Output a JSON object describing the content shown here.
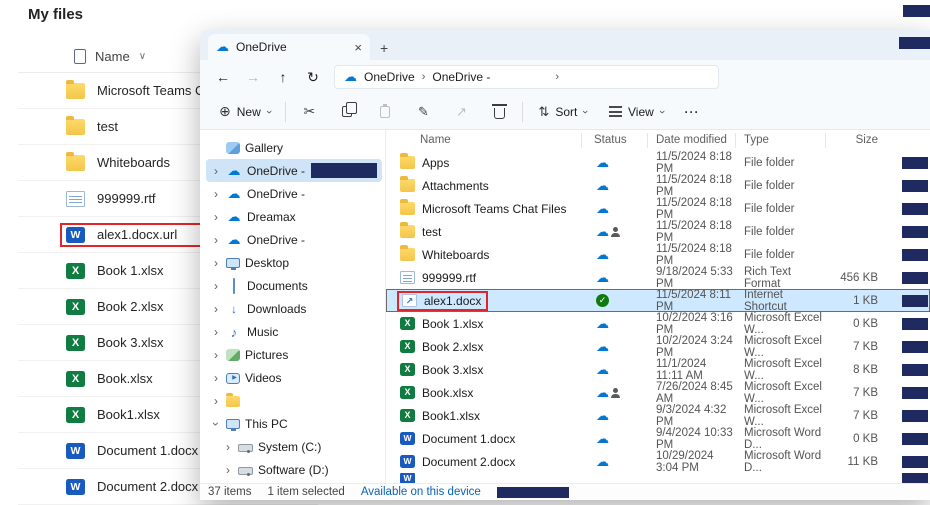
{
  "bg": {
    "title": "My files",
    "header": {
      "name": "Name"
    },
    "files": [
      {
        "name": "Microsoft Teams Chat",
        "icon": "folder"
      },
      {
        "name": "test",
        "icon": "folder"
      },
      {
        "name": "Whiteboards",
        "icon": "folder"
      },
      {
        "name": "999999.rtf",
        "icon": "rtf-file"
      },
      {
        "name": "alex1.docx.url",
        "icon": "word-file",
        "highlighted_red_box": true
      },
      {
        "name": "Book 1.xlsx",
        "icon": "excel-file"
      },
      {
        "name": "Book 2.xlsx",
        "icon": "excel-file"
      },
      {
        "name": "Book 3.xlsx",
        "icon": "excel-file"
      },
      {
        "name": "Book.xlsx",
        "icon": "excel-file"
      },
      {
        "name": "Book1.xlsx",
        "icon": "excel-file"
      },
      {
        "name": "Document 1.docx",
        "icon": "word-file"
      },
      {
        "name": "Document 2.docx",
        "icon": "word-file"
      }
    ]
  },
  "explorer": {
    "tab_title": "OneDrive",
    "breadcrumb": {
      "root": "OneDrive",
      "second": "OneDrive -"
    },
    "toolbar": {
      "new": "New",
      "sort": "Sort",
      "view": "View",
      "more": "···",
      "icons": [
        "new",
        "cut",
        "copy",
        "paste",
        "rename",
        "share",
        "delete",
        "sort",
        "view",
        "more"
      ]
    },
    "nav_icons": [
      "back",
      "forward",
      "up",
      "refresh"
    ],
    "sidebar": [
      {
        "label": "Gallery",
        "icon": "gallery"
      },
      {
        "label": "OneDrive -",
        "icon": "cloud",
        "selected": true,
        "redacted": true
      },
      {
        "label": "OneDrive -",
        "icon": "cloud"
      },
      {
        "label": "Dreamax",
        "icon": "cloud"
      },
      {
        "label": "OneDrive -",
        "icon": "cloud"
      },
      {
        "label": "Desktop",
        "icon": "desktop"
      },
      {
        "label": "Documents",
        "icon": "documents"
      },
      {
        "label": "Downloads",
        "icon": "downloads"
      },
      {
        "label": "Music",
        "icon": "music"
      },
      {
        "label": "Pictures",
        "icon": "pictures"
      },
      {
        "label": "Videos",
        "icon": "videos"
      },
      {
        "label": "",
        "icon": "folder"
      },
      {
        "label": "This PC",
        "icon": "this-pc",
        "expanded": true
      },
      {
        "label": "System (C:)",
        "icon": "drive"
      },
      {
        "label": "Software (D:)",
        "icon": "drive"
      }
    ],
    "columns": [
      "Name",
      "Status",
      "Date modified",
      "Type",
      "Size"
    ],
    "rows": [
      {
        "name": "Apps",
        "icon": "folder",
        "status": "cloud",
        "modified": "11/5/2024 8:18 PM",
        "type": "File folder",
        "size": ""
      },
      {
        "name": "Attachments",
        "icon": "folder",
        "status": "cloud",
        "modified": "11/5/2024 8:18 PM",
        "type": "File folder",
        "size": ""
      },
      {
        "name": "Microsoft Teams Chat Files",
        "icon": "folder",
        "status": "cloud",
        "modified": "11/5/2024 8:18 PM",
        "type": "File folder",
        "size": ""
      },
      {
        "name": "test",
        "icon": "folder",
        "status": "cloud-shared",
        "modified": "11/5/2024 8:18 PM",
        "type": "File folder",
        "size": ""
      },
      {
        "name": "Whiteboards",
        "icon": "folder",
        "status": "cloud",
        "modified": "11/5/2024 8:18 PM",
        "type": "File folder",
        "size": ""
      },
      {
        "name": "999999.rtf",
        "icon": "rtf-file",
        "status": "cloud",
        "modified": "9/18/2024 5:33 PM",
        "type": "Rich Text Format",
        "size": "456 KB"
      },
      {
        "name": "alex1.docx",
        "icon": "internet-shortcut",
        "status": "synced",
        "modified": "11/5/2024 8:11 PM",
        "type": "Internet Shortcut",
        "size": "1 KB",
        "selected": true,
        "highlighted_red_box": true
      },
      {
        "name": "Book 1.xlsx",
        "icon": "excel-file",
        "status": "cloud",
        "modified": "10/2/2024 3:16 PM",
        "type": "Microsoft Excel W...",
        "size": "0 KB"
      },
      {
        "name": "Book 2.xlsx",
        "icon": "excel-file",
        "status": "cloud",
        "modified": "10/2/2024 3:24 PM",
        "type": "Microsoft Excel W...",
        "size": "7 KB"
      },
      {
        "name": "Book 3.xlsx",
        "icon": "excel-file",
        "status": "cloud",
        "modified": "11/1/2024 11:11 AM",
        "type": "Microsoft Excel W...",
        "size": "8 KB"
      },
      {
        "name": "Book.xlsx",
        "icon": "excel-file",
        "status": "cloud-shared",
        "modified": "7/26/2024 8:45 AM",
        "type": "Microsoft Excel W...",
        "size": "7 KB"
      },
      {
        "name": "Book1.xlsx",
        "icon": "excel-file",
        "status": "cloud",
        "modified": "9/3/2024 4:32 PM",
        "type": "Microsoft Excel W...",
        "size": "7 KB"
      },
      {
        "name": "Document 1.docx",
        "icon": "word-file",
        "status": "cloud",
        "modified": "9/4/2024 10:33 PM",
        "type": "Microsoft Word D...",
        "size": "0 KB"
      },
      {
        "name": "Document 2.docx",
        "icon": "word-file",
        "status": "cloud",
        "modified": "10/29/2024 3:04 PM",
        "type": "Microsoft Word D...",
        "size": "11 KB"
      },
      {
        "name": "",
        "icon": "word-file",
        "status": "",
        "modified": "",
        "type": "",
        "size": ""
      }
    ],
    "status_bar": {
      "count": "37 items",
      "selected": "1 item selected",
      "availability": "Available on this device"
    }
  },
  "colors": {
    "accent": "#0078d4",
    "selection": "#cde8ff",
    "highlight_red": "#e3242b",
    "redaction_navy": "#1f2a60",
    "folder_yellow": "#f2c64a",
    "excel_green": "#107c41",
    "word_blue": "#185abd",
    "check_green": "#0f7b0f"
  }
}
